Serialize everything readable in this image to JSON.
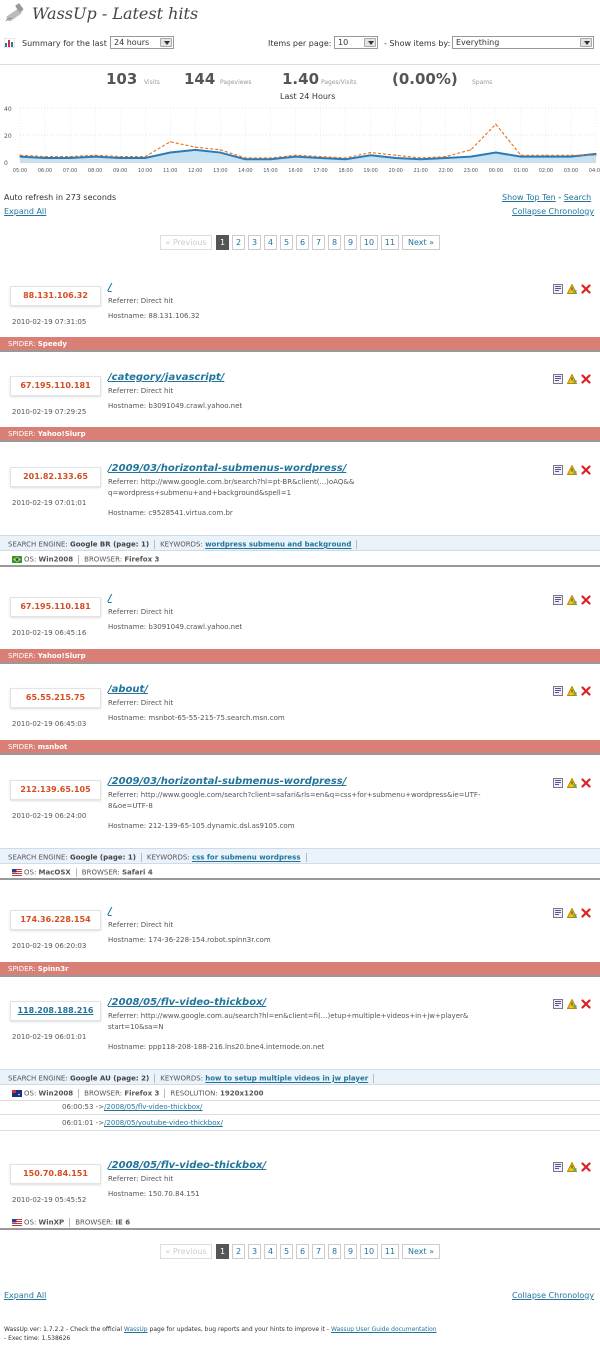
{
  "header": {
    "title": "WassUp - Latest hits"
  },
  "controls": {
    "summary_label": "Summary for the last",
    "summary_value": "24 hours",
    "items_label": "Items per page:",
    "items_value": "10",
    "show_label": "- Show items by:",
    "show_value": "Everything"
  },
  "stats": {
    "visits": "103",
    "visits_label": "Visits",
    "pageviews": "144",
    "pageviews_label": "Pageviews",
    "ppv": "1.40",
    "ppv_label": "Pages/Visits",
    "spams": "(0.00%)",
    "spams_label": "Spams",
    "period": "Last 24 Hours"
  },
  "chart_data": {
    "type": "line",
    "x": [
      "05:00",
      "06:00",
      "07:00",
      "08:00",
      "09:00",
      "10:00",
      "11:00",
      "12:00",
      "13:00",
      "14:00",
      "15:00",
      "16:00",
      "17:00",
      "18:00",
      "19:00",
      "20:00",
      "21:00",
      "22:00",
      "23:00",
      "00:00",
      "01:00",
      "02:00",
      "03:00",
      "04:00"
    ],
    "ylim": [
      0,
      40
    ],
    "yticks": [
      "40",
      "20",
      "0"
    ],
    "grid": true,
    "series": [
      {
        "values": [
          4,
          3,
          3,
          4,
          3,
          3,
          7,
          9,
          7,
          2,
          2,
          4,
          3,
          2,
          5,
          3,
          2,
          3,
          4,
          7,
          4,
          4,
          4,
          6
        ],
        "color": "#2a7ab8"
      },
      {
        "values": [
          5,
          4,
          4,
          5,
          4,
          4,
          15,
          11,
          9,
          3,
          3,
          5,
          4,
          3,
          7,
          5,
          3,
          4,
          9,
          28,
          5,
          5,
          5,
          5
        ],
        "color": "#e07020",
        "dashed": true
      }
    ]
  },
  "links": {
    "auto_refresh": "Auto refresh in 273 seconds",
    "show_top_ten": "Show Top Ten",
    "dash": "-",
    "search": "Search",
    "expand_all": "Expand All",
    "collapse": "Collapse Chronology"
  },
  "pager": {
    "prev": "« Previous",
    "pages": [
      "1",
      "2",
      "3",
      "4",
      "5",
      "6",
      "7",
      "8",
      "9",
      "10",
      "11"
    ],
    "next": "Next »"
  },
  "labels": {
    "referrer": "Referrer:",
    "hostname": "Hostname:",
    "spider": "SPIDER:",
    "search_engine": "SEARCH ENGINE:",
    "keywords": "KEYWORDS:",
    "os": "OS:",
    "browser": "BROWSER:",
    "resolution": "RESOLUTION:"
  },
  "hits": [
    {
      "ip": "88.131.106.32",
      "date": "2010-02-19 07:31:05",
      "url": "/",
      "referrer": "Direct hit",
      "hostname": "88.131.106.32",
      "spider": "Speedy"
    },
    {
      "ip": "67.195.110.181",
      "date": "2010-02-19 07:29:25",
      "url": "/category/javascript/",
      "referrer": "Direct hit",
      "hostname": "b3091049.crawl.yahoo.net",
      "spider": "Yahoo!Slurp"
    },
    {
      "ip": "201.82.133.65",
      "date": "2010-02-19 07:01:01",
      "url": "/2009/03/horizontal-submenus-wordpress/",
      "referrer": "http://www.google.com.br/search?hl=pt-BR&client(...)oAQ&&",
      "referrer2": "q=wordpress+submenu+and+background&spell=1",
      "hostname": "c9528541.virtua.com.br",
      "search_engine": "Google BR (page: 1)",
      "keywords": "wordpress submenu and background",
      "os": "Win2008",
      "browser": "Firefox 3"
    },
    {
      "ip": "67.195.110.181",
      "date": "2010-02-19 06:45:16",
      "url": "/",
      "referrer": "Direct hit",
      "hostname": "b3091049.crawl.yahoo.net",
      "spider": "Yahoo!Slurp"
    },
    {
      "ip": "65.55.215.75",
      "date": "2010-02-19 06:45:03",
      "url": "/about/",
      "referrer": "Direct hit",
      "hostname": "msnbot-65-55-215-75.search.msn.com",
      "spider": "msnbot"
    },
    {
      "ip": "212.139.65.105",
      "date": "2010-02-19 06:24:00",
      "url": "/2009/03/horizontal-submenus-wordpress/",
      "referrer": "http://www.google.com/search?client=safari&rls=en&q=css+for+submenu+wordpress&ie=UTF-",
      "referrer2": "8&oe=UTF-8",
      "hostname": "212-139-65-105.dynamic.dsl.as9105.com",
      "search_engine": "Google (page: 1)",
      "keywords": "css for submenu wordpress",
      "os": "MacOSX",
      "browser": "Safari 4"
    },
    {
      "ip": "174.36.228.154",
      "date": "2010-02-19 06:20:03",
      "url": "/",
      "referrer": "Direct hit",
      "hostname": "174-36-228-154.robot.spinn3r.com",
      "spider": "Spinn3r"
    },
    {
      "ip": "118.208.188.216",
      "date": "2010-02-19 06:01:01",
      "url": "/2008/05/flv-video-thickbox/",
      "referrer": "http://www.google.com.au/search?hl=en&client=fi(...)etup+multiple+videos+in+jw+player&",
      "referrer2": "start=10&sa=N",
      "hostname": "ppp118-208-188-216.lns20.bne4.internode.on.net",
      "search_engine": "Google AU (page: 2)",
      "keywords": "how to setup multiple videos in jw player",
      "os": "Win2008",
      "browser": "Firefox 3",
      "resolution": "1920x1200",
      "chrono": [
        {
          "time": "06:00:53 ->",
          "url": "/2008/05/flv-video-thickbox/"
        },
        {
          "time": "06:01:01 ->",
          "url": "/2008/05/youtube-video-thickbox/"
        }
      ]
    },
    {
      "ip": "150.70.84.151",
      "date": "2010-02-19 05:45:52",
      "url": "/2008/05/flv-video-thickbox/",
      "referrer": "Direct hit",
      "hostname": "150.70.84.151",
      "os": "WinXP",
      "browser": "IE 6"
    }
  ],
  "footer": {
    "t1": "WassUp ver: 1.7.2.2 - Check the official",
    "wassup_link": "WassUp",
    "t2": "page for updates, bug reports and your hints to improve it -",
    "guide_link": "Wassup User Guide documentation",
    "exec": "- Exec time: 1.538626"
  }
}
